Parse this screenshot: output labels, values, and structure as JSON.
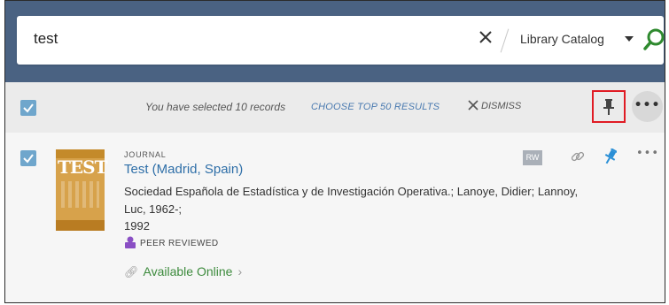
{
  "search": {
    "query": "test",
    "scope": "Library Catalog"
  },
  "selection_bar": {
    "message": "You have selected 10 records",
    "choose_label": "CHOOSE TOP 50 RESULTS",
    "dismiss_label": "DISMISS",
    "more_label": "•••"
  },
  "result": {
    "cover_text": "TEST",
    "type": "JOURNAL",
    "title": "Test (Madrid, Spain)",
    "authors": "Sociedad Española de Estadística y de Investigación Operativa.; Lanoye, Didier; Lannoy, Luc, 1962-;",
    "year": "1992",
    "peer_reviewed": "PEER REVIEWED",
    "availability": "Available Online",
    "rw_badge": "RW",
    "more_label": "•••"
  },
  "colors": {
    "header_band": "#4a6282",
    "accent_blue": "#2f6fa8",
    "checkbox_blue": "#6fa6cc",
    "available_green": "#3d8b3d",
    "highlight_red": "#e01b24"
  }
}
